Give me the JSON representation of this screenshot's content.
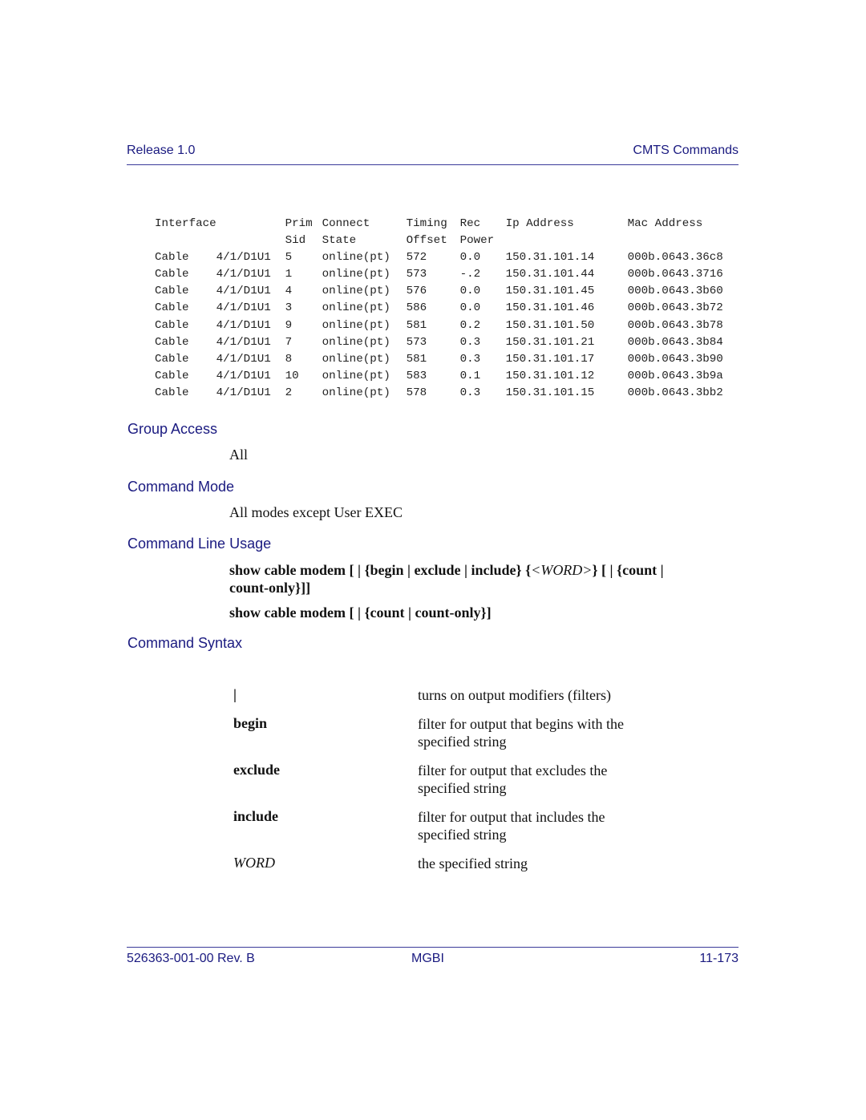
{
  "header": {
    "left": "Release 1.0",
    "right": "CMTS Commands"
  },
  "cli_output": {
    "header_row1": [
      "Interface",
      "",
      "Prim",
      "Connect",
      "Timing",
      "Rec",
      "Ip Address",
      "Mac Address"
    ],
    "header_row2": [
      "",
      "",
      "Sid",
      "State",
      "Offset",
      "Power",
      "",
      ""
    ],
    "rows": [
      [
        "Cable",
        "4/1/D1U1",
        "5",
        "online(pt)",
        "572",
        "0.0",
        "150.31.101.14",
        "000b.0643.36c8"
      ],
      [
        "Cable",
        "4/1/D1U1",
        "1",
        "online(pt)",
        "573",
        "-.2",
        "150.31.101.44",
        "000b.0643.3716"
      ],
      [
        "Cable",
        "4/1/D1U1",
        "4",
        "online(pt)",
        "576",
        "0.0",
        "150.31.101.45",
        "000b.0643.3b60"
      ],
      [
        "Cable",
        "4/1/D1U1",
        "3",
        "online(pt)",
        "586",
        "0.0",
        "150.31.101.46",
        "000b.0643.3b72"
      ],
      [
        "Cable",
        "4/1/D1U1",
        "9",
        "online(pt)",
        "581",
        "0.2",
        "150.31.101.50",
        "000b.0643.3b78"
      ],
      [
        "Cable",
        "4/1/D1U1",
        "7",
        "online(pt)",
        "573",
        "0.3",
        "150.31.101.21",
        "000b.0643.3b84"
      ],
      [
        "Cable",
        "4/1/D1U1",
        "8",
        "online(pt)",
        "581",
        "0.3",
        "150.31.101.17",
        "000b.0643.3b90"
      ],
      [
        "Cable",
        "4/1/D1U1",
        "10",
        "online(pt)",
        "583",
        "0.1",
        "150.31.101.12",
        "000b.0643.3b9a"
      ],
      [
        "Cable",
        "4/1/D1U1",
        "2",
        "online(pt)",
        "578",
        "0.3",
        "150.31.101.15",
        "000b.0643.3bb2"
      ]
    ]
  },
  "sections": {
    "group_access": {
      "title": "Group Access",
      "text": "All"
    },
    "command_mode": {
      "title": "Command Mode",
      "text": "All modes except User EXEC"
    },
    "command_line_usage": {
      "title": "Command Line Usage",
      "line1_a": "show cable modem [ | {begin | exclude | include} {",
      "line1_word": "<WORD>",
      "line1_b": "} [ | {count |",
      "line1_c": "count-only}]]",
      "line2": "show cable modem [ | {count | count-only}]"
    },
    "command_syntax": {
      "title": "Command Syntax",
      "rows": [
        {
          "term": "|",
          "desc": "turns on output modifiers (filters)"
        },
        {
          "term": "begin",
          "desc": "filter for output that begins with the specified string"
        },
        {
          "term": "exclude",
          "desc": "filter for output that excludes the specified string"
        },
        {
          "term": "include",
          "desc": "filter for output that includes the specified string"
        },
        {
          "term": "WORD",
          "desc": "the specified string"
        }
      ]
    }
  },
  "footer": {
    "left": "526363-001-00 Rev. B",
    "center": "MGBI",
    "right": "11-173"
  }
}
